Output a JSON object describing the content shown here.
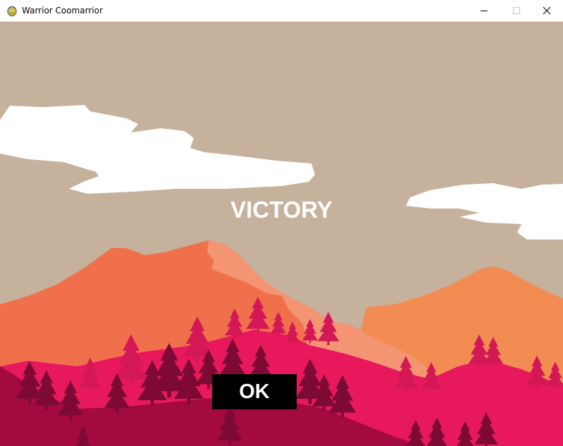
{
  "window": {
    "title": "Warrior Coomarrior",
    "app_icon": "pygame-snake-icon",
    "controls": [
      "minimize-icon",
      "maximize-icon",
      "close-icon"
    ]
  },
  "game": {
    "message": "VICTORY",
    "ok_label": "OK"
  },
  "colors": {
    "sky": "#c6b19c",
    "cloud": "#ffffff",
    "mountain_orange": "#f0704c",
    "mountain_peach": "#f39473",
    "mountain_right": "#f38c52",
    "hill_pink": "#e8185d",
    "tree_pink": "#d41855",
    "hill_dark": "#a30a3f",
    "tree_dark": "#7c0a35",
    "button_bg": "#000000",
    "text": "#ffffff"
  }
}
